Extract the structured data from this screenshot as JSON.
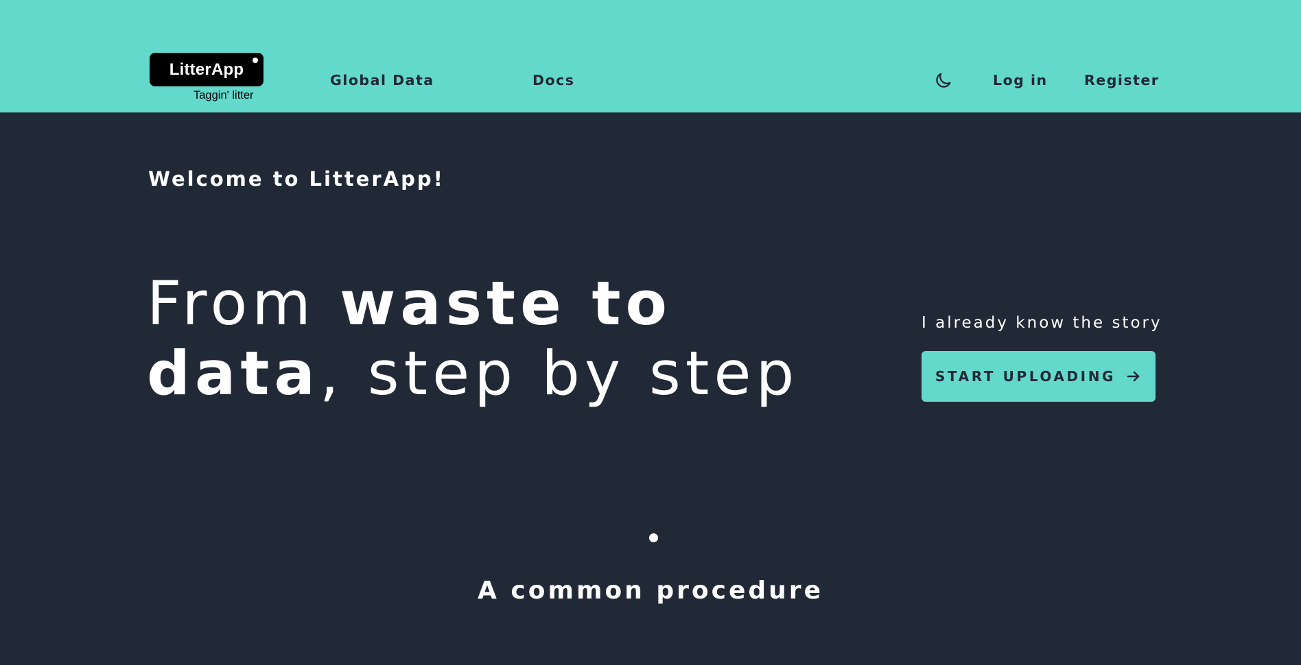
{
  "header": {
    "logo": {
      "name": "LitterApp",
      "tagline": "Taggin' litter"
    },
    "nav": {
      "global_data": "Global Data",
      "docs": "Docs",
      "login": "Log in",
      "register": "Register"
    },
    "theme_toggle_icon": "moon-icon"
  },
  "hero": {
    "welcome": "Welcome to LitterApp!",
    "headline": {
      "part1": "From ",
      "part2": "waste to",
      "part3": "data",
      "part4": ", step by step"
    },
    "story_link": "I already know the story",
    "cta": {
      "label": "START UPLOADING",
      "icon": "arrow-right-icon"
    }
  },
  "section": {
    "title": "A common procedure"
  },
  "colors": {
    "accent": "#63d9cc",
    "background": "#222936",
    "text": "#ffffff"
  }
}
